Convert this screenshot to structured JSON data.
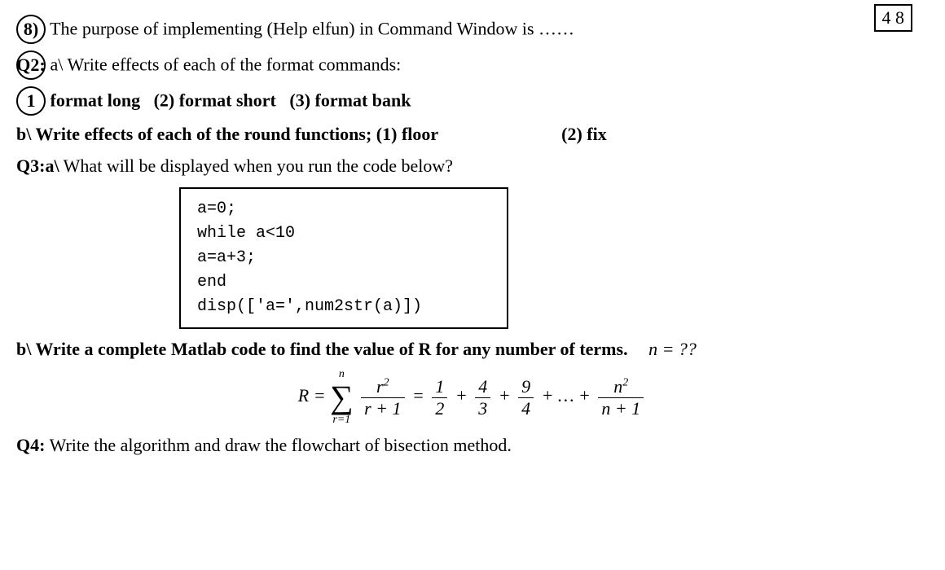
{
  "q8": {
    "num": "8)",
    "text": "The purpose of implementing (Help elfun) in Command Window is ……"
  },
  "q2": {
    "label": "Q2:",
    "part_a_intro": "a\\ Write effects of each of the format commands:",
    "opt1_num": "1",
    "opt1": "format long",
    "opt2": "(2) format short",
    "opt3": "(3) format bank",
    "part_b": "b\\ Write effects of each of the round functions;",
    "b_opt1": "(1) floor",
    "b_opt2": "(2) fix"
  },
  "q3": {
    "label": "Q3:a\\",
    "text": "What will be displayed when you run the code below?",
    "code": {
      "l1": "a=0;",
      "l2": "while a<10",
      "l3": "a=a+3;",
      "l4": "end",
      "l5": "disp(['a=',num2str(a)])"
    },
    "part_b": "b\\ Write a complete Matlab code to find the value of R for any number of terms.",
    "hand_note": "n = ??"
  },
  "formula": {
    "lhs": "R =",
    "sigma_top": "n",
    "sigma_bot": "r=1",
    "term_num": "r",
    "term_num_sup": "2",
    "term_den": "r + 1",
    "eq": "=",
    "f1n": "1",
    "f1d": "2",
    "f2n": "4",
    "f2d": "3",
    "f3n": "9",
    "f3d": "4",
    "dots": "+ … +",
    "fnn": "n",
    "fnn_sup": "2",
    "fnd": "n + 1"
  },
  "q4": {
    "label": "Q4:",
    "text": "Write the algorithm and draw the flowchart of bisection method."
  },
  "corner": {
    "vals": "4  8"
  }
}
